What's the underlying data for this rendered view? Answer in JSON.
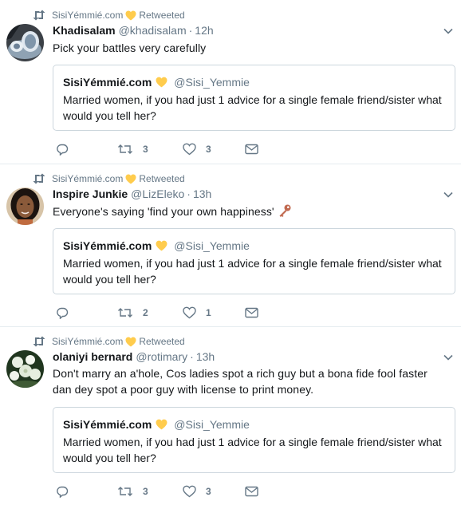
{
  "tweets": [
    {
      "retweeter": "SisiYémmié.com",
      "retweeted_label": "Retweeted",
      "name": "Khadisalam",
      "handle": "@khadisalam",
      "time": "12h",
      "text": "Pick your battles very carefully",
      "quote": {
        "name": "SisiYémmié.com",
        "handle": "@Sisi_Yemmie",
        "text": "Married women, if you had just 1 advice for a single female friend/sister what would you tell her?"
      },
      "retweets": "3",
      "likes": "3",
      "avatar_icon": "tea-set-photo"
    },
    {
      "retweeter": "SisiYémmié.com",
      "retweeted_label": "Retweeted",
      "name": "Inspire Junkie",
      "handle": "@LizEleko",
      "time": "13h",
      "text": "Everyone's saying 'find your own happiness'",
      "text_emoji": "key-emoji",
      "quote": {
        "name": "SisiYémmié.com",
        "handle": "@Sisi_Yemmie",
        "text": "Married women, if you had just 1 advice for a single female friend/sister what would you tell her?"
      },
      "retweets": "2",
      "likes": "1",
      "avatar_icon": "woman-portrait-photo"
    },
    {
      "retweeter": "SisiYémmié.com",
      "retweeted_label": "Retweeted",
      "name": "olaniyi bernard",
      "handle": "@rotimary",
      "time": "13h",
      "text": "Don't marry an a'hole, Cos ladies spot a rich guy but a bona fide fool faster dan dey spot a poor guy with license to print money.",
      "quote": {
        "name": "SisiYémmié.com",
        "handle": "@Sisi_Yemmie",
        "text": "Married women, if you had just 1 advice for a single female friend/sister what would you tell her?"
      },
      "retweets": "3",
      "likes": "3",
      "avatar_icon": "flowers-photo"
    }
  ],
  "colors": {
    "text": "#14171a",
    "muted": "#657786",
    "border": "#e6ecf0",
    "quote_border": "#ccd6dd",
    "heart_emoji": "#ffcc4d"
  }
}
